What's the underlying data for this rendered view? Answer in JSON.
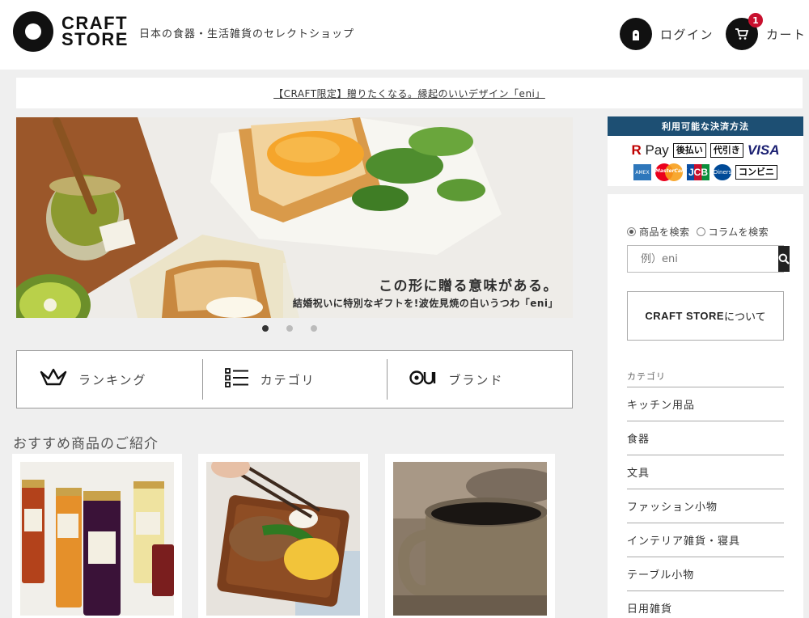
{
  "header": {
    "logo_line1": "CRAFT",
    "logo_line2": "STORE",
    "tagline": "日本の食器・生活雑貨のセレクトショップ",
    "login_label": "ログイン",
    "cart_label": "カート",
    "cart_count": "1"
  },
  "notice": {
    "text": "【CRAFT限定】贈りたくなる。縁起のいいデザイン「eni」"
  },
  "hero": {
    "headline": "この形に贈る意味がある。",
    "subline": "結婚祝いに特別なギフトを!波佐見焼の白いうつわ「eni」",
    "slide_count": 3,
    "active_slide": 1
  },
  "nav": [
    {
      "label": "ランキング",
      "icon": "crown-icon"
    },
    {
      "label": "カテゴリ",
      "icon": "list-icon"
    },
    {
      "label": "ブランド",
      "icon": "brand-icon"
    }
  ],
  "recommend": {
    "title": "おすすめ商品のご紹介"
  },
  "payment": {
    "title": "利用可能な決済方法",
    "rpay_r": "R",
    "rpay_rest": " Pay",
    "atobarai": "後払い",
    "daibiki": "代引き",
    "visa": "VISA",
    "amex": "AMEX",
    "mastercard": "MasterCard",
    "jcb": "JCB",
    "diners": "Diners",
    "konbini": "コンビニ"
  },
  "sidebar": {
    "search_modes": [
      {
        "label": "商品を検索",
        "checked": true
      },
      {
        "label": "コラムを検索",
        "checked": false
      }
    ],
    "search_placeholder": "例）eni",
    "about_brand": "CRAFT STORE",
    "about_suffix": "について",
    "category_heading": "カテゴリ",
    "categories": [
      "キッチン用品",
      "食器",
      "文具",
      "ファッション小物",
      "インテリア雑貨・寝具",
      "テーブル小物",
      "日用雑貨"
    ]
  }
}
